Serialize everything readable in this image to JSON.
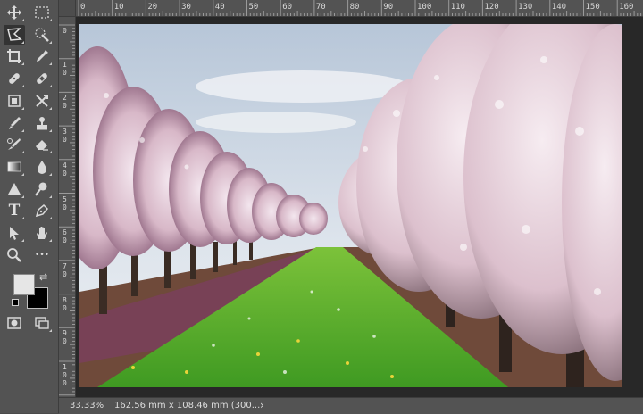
{
  "tools": [
    {
      "name": "move-tool",
      "icon": "move-icon"
    },
    {
      "name": "marquee-tool",
      "icon": "rect-marquee-icon"
    },
    {
      "name": "lasso-tool",
      "icon": "polygon-lasso-icon",
      "active": true
    },
    {
      "name": "quick-select-tool",
      "icon": "quick-select-icon"
    },
    {
      "name": "crop-tool",
      "icon": "crop-icon"
    },
    {
      "name": "eyedropper-tool",
      "icon": "eyedropper-icon"
    },
    {
      "name": "healing-brush-tool",
      "icon": "bandage-icon"
    },
    {
      "name": "healing-patch-tool",
      "icon": "bandage-alt-icon"
    },
    {
      "name": "frame-tool",
      "icon": "frame-icon"
    },
    {
      "name": "content-aware-move-tool",
      "icon": "cross-arrows-icon"
    },
    {
      "name": "brush-tool",
      "icon": "brush-icon"
    },
    {
      "name": "clone-stamp-tool",
      "icon": "stamp-icon"
    },
    {
      "name": "history-brush-tool",
      "icon": "history-brush-icon"
    },
    {
      "name": "eraser-tool",
      "icon": "eraser-icon"
    },
    {
      "name": "gradient-tool",
      "icon": "gradient-icon"
    },
    {
      "name": "blur-tool",
      "icon": "drop-icon"
    },
    {
      "name": "sharpen-tool",
      "icon": "triangle-icon"
    },
    {
      "name": "dodge-tool",
      "icon": "dodge-icon"
    },
    {
      "name": "type-tool",
      "icon": "type-icon",
      "glyph": "T"
    },
    {
      "name": "pen-tool",
      "icon": "pen-icon"
    },
    {
      "name": "path-select-tool",
      "icon": "arrow-icon"
    },
    {
      "name": "hand-tool",
      "icon": "hand-icon"
    },
    {
      "name": "zoom-tool",
      "icon": "zoom-icon"
    },
    {
      "name": "more-tools",
      "icon": "more-icon",
      "glyph": "•••"
    },
    {
      "name": "screen-mode-toggle",
      "icon": "screen-mode-icon"
    },
    {
      "name": "quick-mask-toggle",
      "icon": "quick-mask-icon"
    }
  ],
  "colors": {
    "foreground": "#e6e6e6",
    "background": "#000000"
  },
  "ruler_top": [
    "0",
    "10",
    "20",
    "30",
    "40",
    "50",
    "60",
    "70",
    "80",
    "90",
    "100",
    "110",
    "120",
    "130",
    "140",
    "150",
    "160"
  ],
  "ruler_left": [
    "0",
    "1 0",
    "2 0",
    "3 0",
    "4 0",
    "5 0",
    "6 0",
    "7 0",
    "8 0",
    "9 0",
    "1 0 0"
  ],
  "status": {
    "zoom": "33.33%",
    "doc_size": "162.56 mm x 108.46 mm (300...",
    "arrow": "›"
  }
}
